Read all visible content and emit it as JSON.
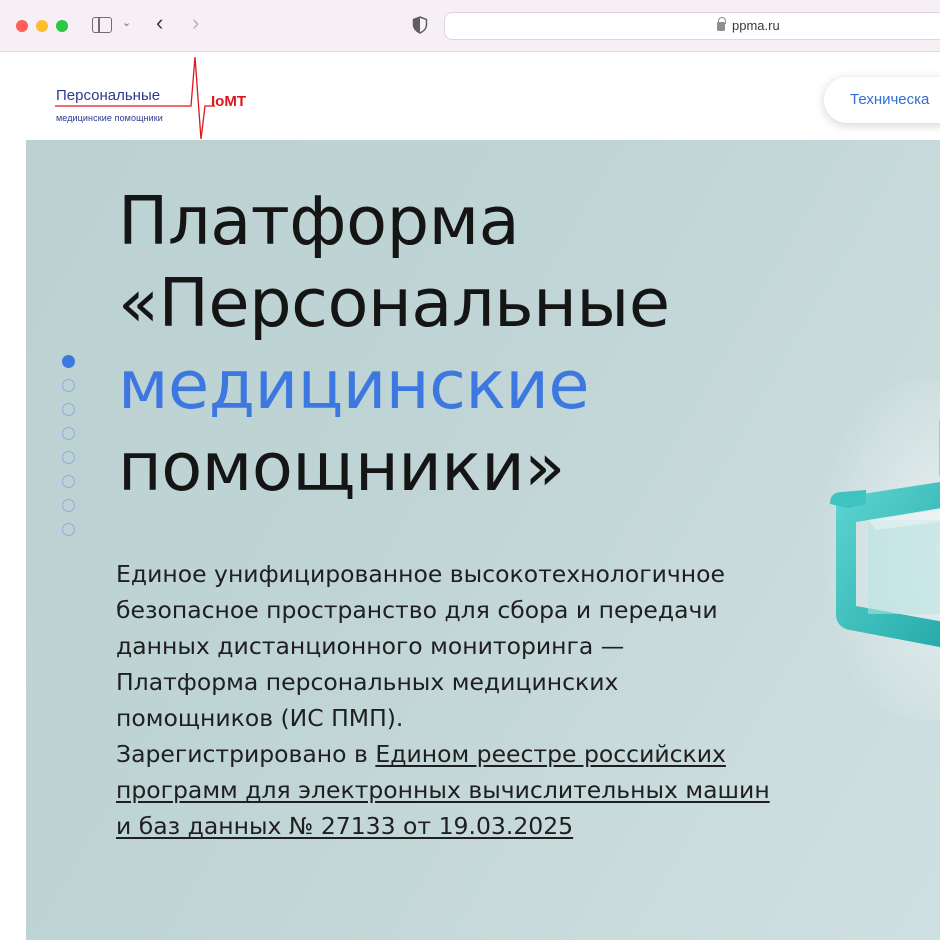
{
  "browser": {
    "url": "ppma.ru"
  },
  "header": {
    "logo": {
      "title": "Персональные",
      "subtitle": "медицинские помощники",
      "mark": "IoMT"
    },
    "tech_button_label": "Техническа"
  },
  "hero": {
    "title_lines": [
      "Платформа",
      "«Персональные",
      "медицинские",
      "помощники»"
    ],
    "accent_color": "#3d78e0",
    "description_lines": [
      "Единое унифицированное высокотехнологичное",
      "безопасное пространство для сбора и передачи",
      "данных дистанционного мониторинга —",
      "Платформа персональных медицинских",
      "помощников (ИС ПМП)."
    ],
    "registered_prefix": "Зарегистрировано в ",
    "registry_link_lines": [
      "Едином реестре российских",
      "программ для электронных вычислительных машин",
      "и баз данных № 27133 от 19.03.2025"
    ],
    "slider": {
      "total": 8,
      "active": 1
    }
  },
  "icons": {
    "sidebar": "sidebar-toggle-icon",
    "back": "chevron-left-icon",
    "forward": "chevron-right-icon",
    "shield": "shield-icon",
    "lock": "lock-icon"
  }
}
